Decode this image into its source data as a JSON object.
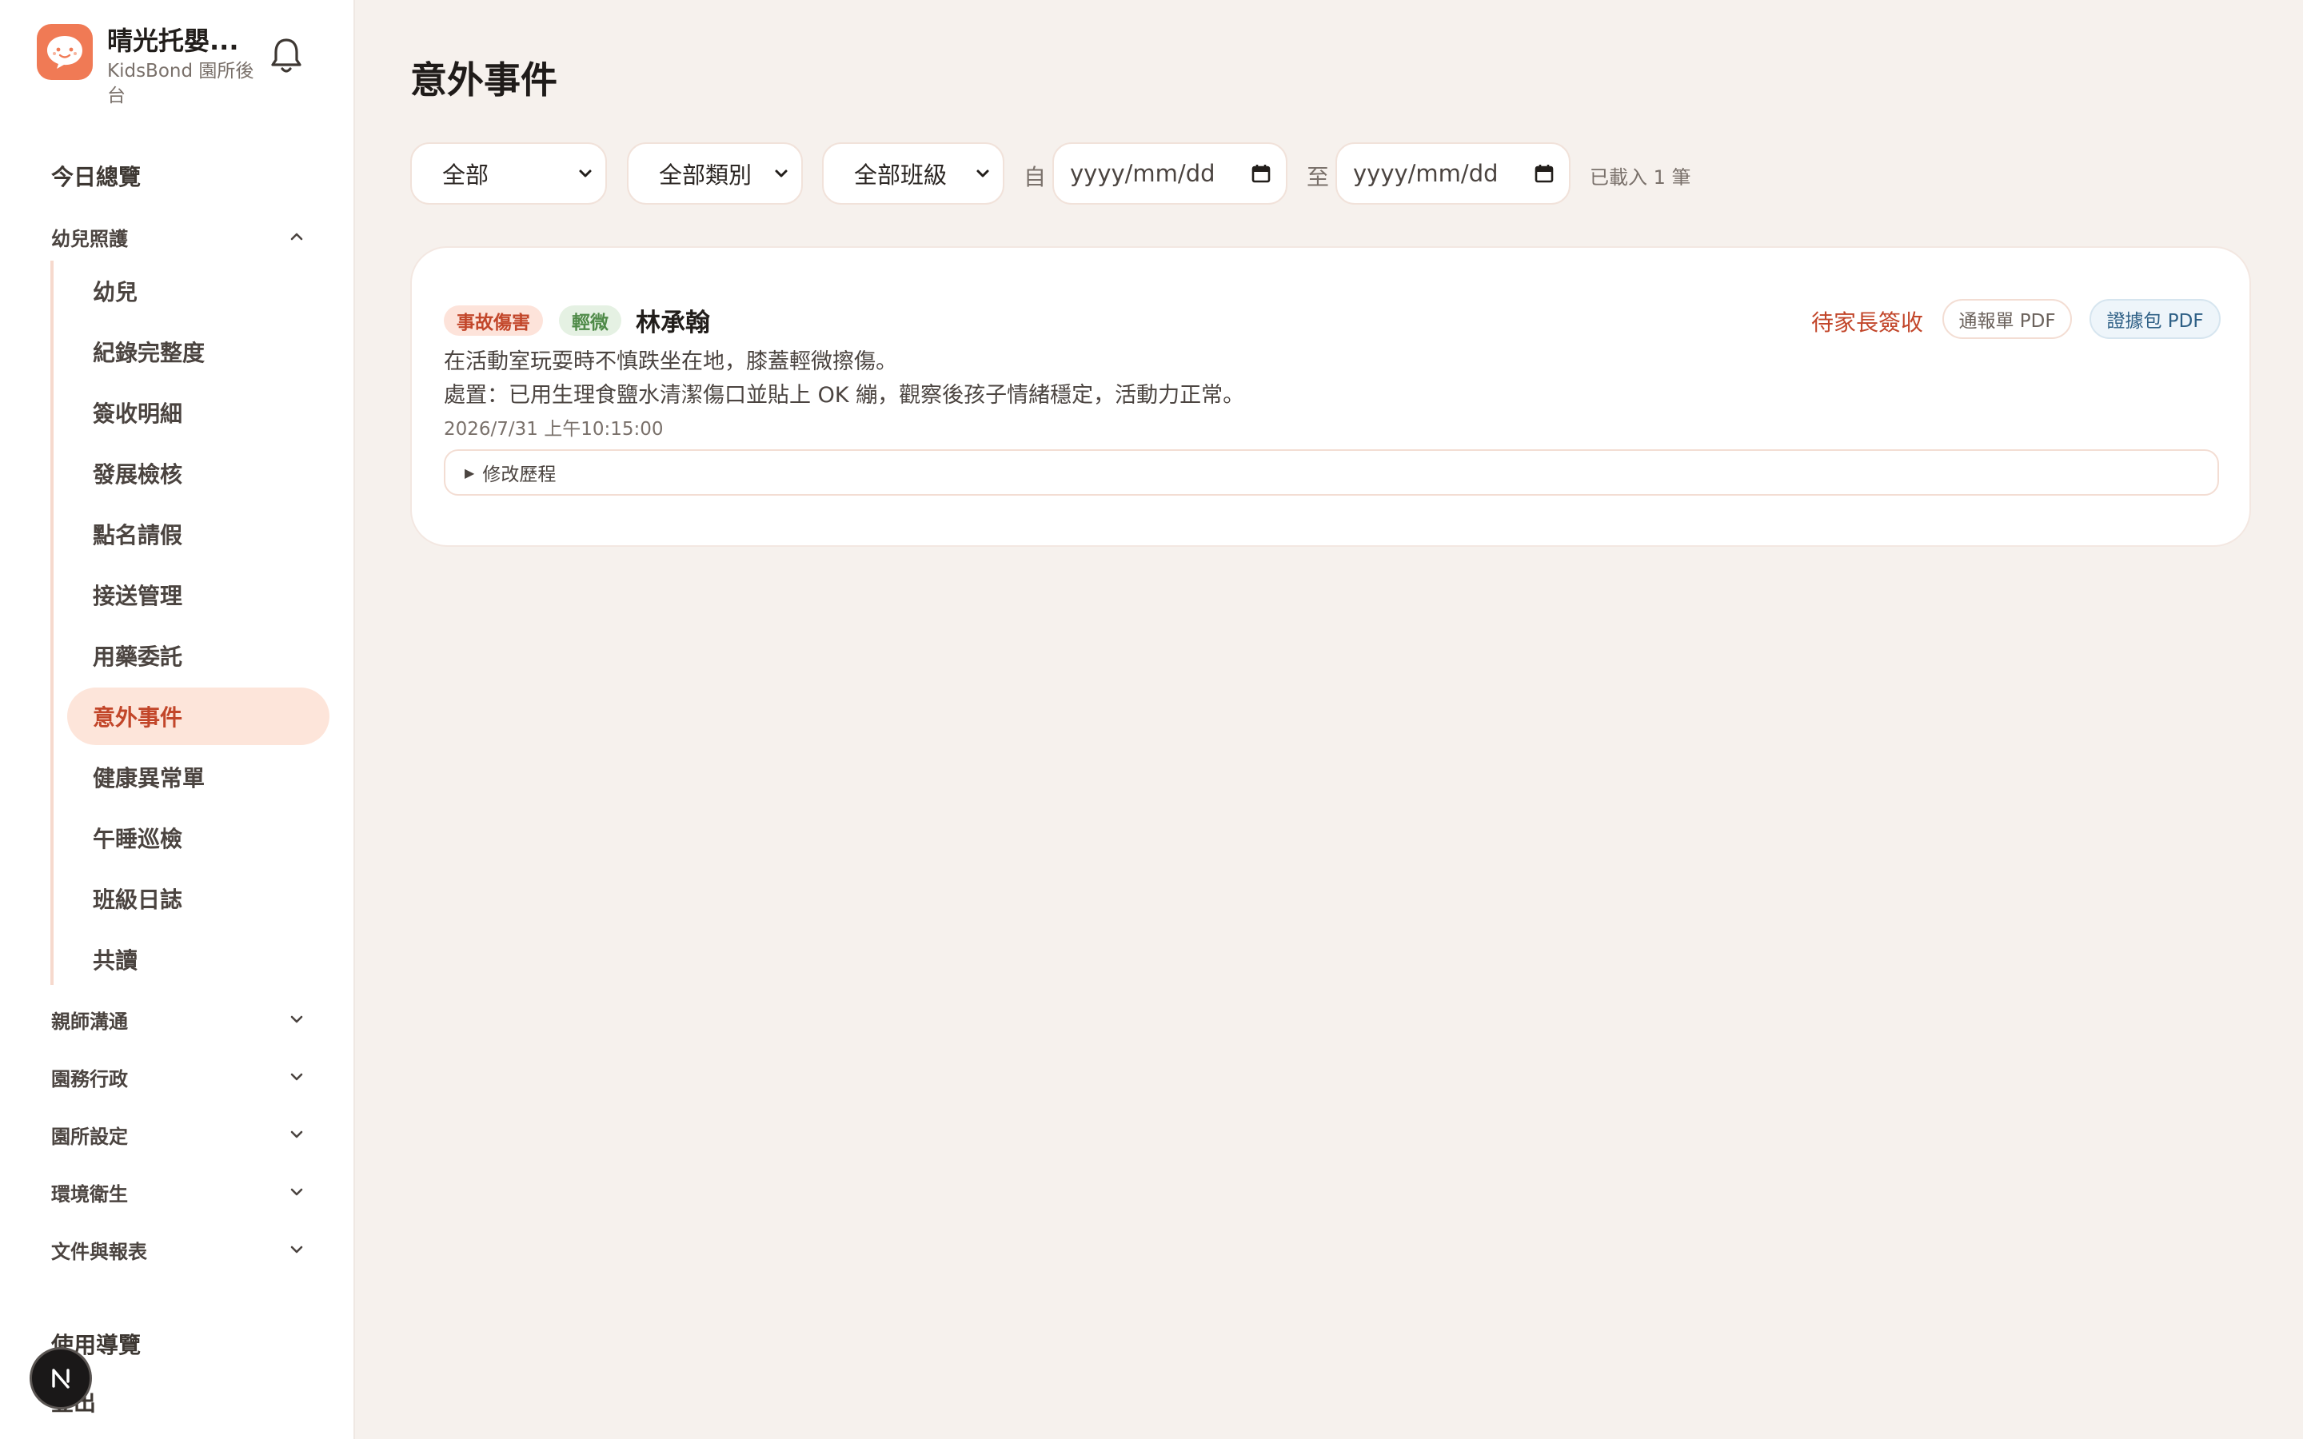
{
  "brand": {
    "name": "晴光托嬰...",
    "subtitle": "KidsBond 園所後台"
  },
  "colors": {
    "accent": "#f07a55",
    "active_bg": "#fde5da",
    "active_text": "#c2462a",
    "page_bg": "#f6f1ed"
  },
  "sidebar": {
    "overview": "今日總覽",
    "childcare_group": "幼兒照護",
    "childcare_items": [
      "幼兒",
      "紀錄完整度",
      "簽收明細",
      "發展檢核",
      "點名請假",
      "接送管理",
      "用藥委託",
      "意外事件",
      "健康異常單",
      "午睡巡檢",
      "班級日誌",
      "共讀"
    ],
    "active_item": "意外事件",
    "groups": [
      "親師溝通",
      "園務行政",
      "園所設定",
      "環境衛生",
      "文件與報表"
    ],
    "guide": "使用導覽",
    "logout": "登出"
  },
  "page": {
    "title": "意外事件",
    "filters": {
      "status": "全部",
      "category": "全部類別",
      "class": "全部班級",
      "from_label": "自",
      "to_label": "至",
      "date_placeholder": "yyyy/mm/dd",
      "loaded_count": "已載入 1 筆"
    }
  },
  "incident": {
    "type_tag": "事故傷害",
    "severity_tag": "輕微",
    "child_name": "林承翰",
    "description": "在活動室玩耍時不慎跌坐在地，膝蓋輕微擦傷。",
    "handling": "處置：已用生理食鹽水清潔傷口並貼上 OK 繃，觀察後孩子情緒穩定，活動力正常。",
    "datetime": "2026/7/31 上午10:15:00",
    "status": "待家長簽收",
    "notify_pdf": "通報單 PDF",
    "evidence_pdf": "證據包 PDF",
    "history_label": "修改歷程"
  }
}
